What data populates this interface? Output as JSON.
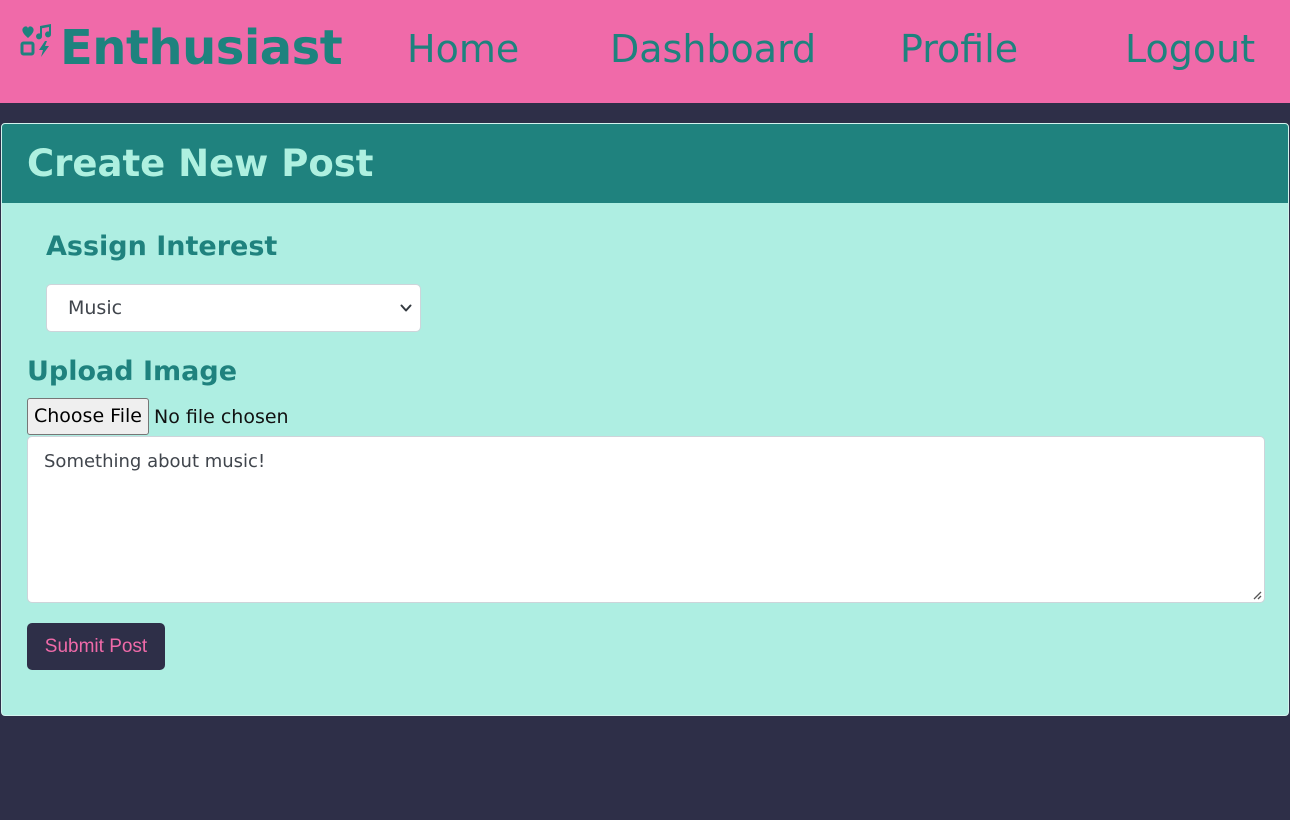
{
  "nav": {
    "brand": "Enthusiast",
    "brand_icon": "interests-icon",
    "links": [
      "Home",
      "Dashboard",
      "Profile",
      "Logout"
    ]
  },
  "form": {
    "title": "Create New Post",
    "interest_label": "Assign Interest",
    "interest_selected": "Music",
    "upload_label": "Upload Image",
    "file_button": "Choose File",
    "file_status": "No file chosen",
    "text_value": "Something about music!",
    "submit_label": "Submit Post"
  },
  "colors": {
    "nav_bg": "#f06aa9",
    "accent_teal": "#1f827e",
    "card_bg": "#aeeee2",
    "page_bg": "#2e2f48",
    "submit_text": "#f06aa9"
  }
}
